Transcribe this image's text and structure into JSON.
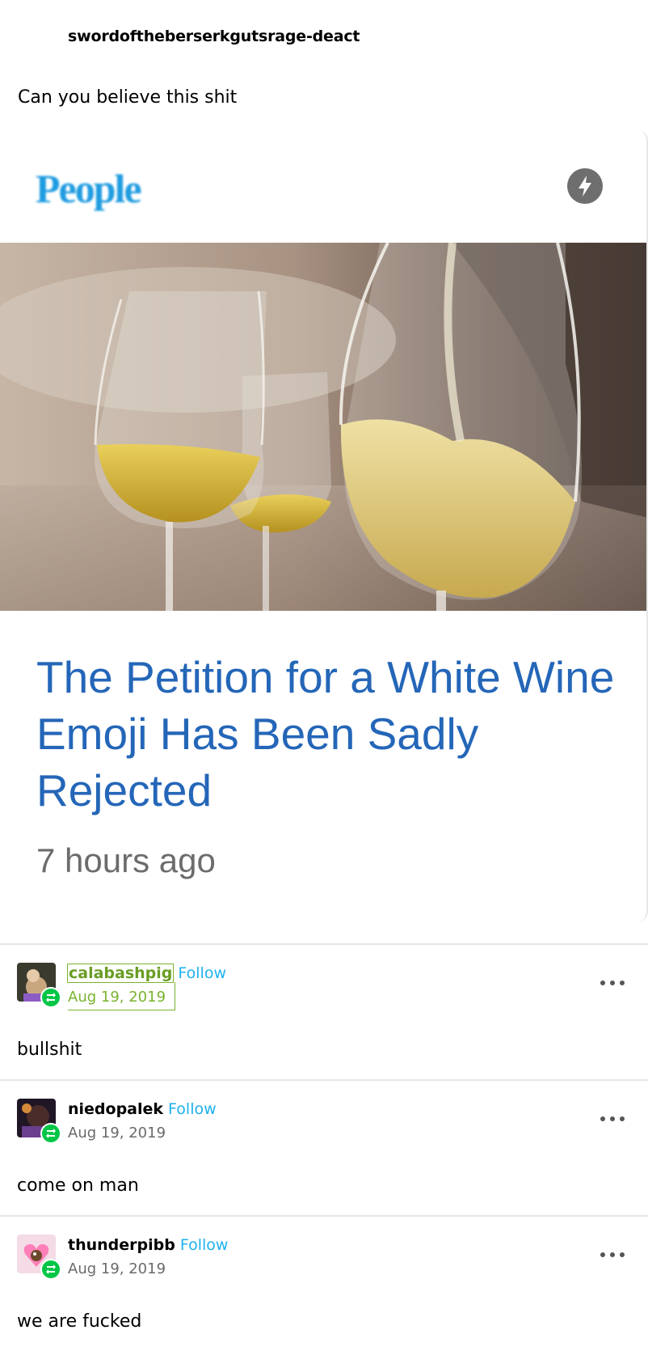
{
  "op": {
    "username": "swordoftheberserkgutsrage-deact",
    "text": "Can you believe this shit"
  },
  "card": {
    "source_logo": "People",
    "amp_icon": "lightning-bolt-icon",
    "title": "The Petition for a White Wine Emoji Has Been Sadly Rejected",
    "time": "7 hours ago"
  },
  "reblogs": [
    {
      "username": "calabashpig",
      "follow": "Follow",
      "date": "Aug 19, 2019",
      "text": "bullshit"
    },
    {
      "username": "niedopalek",
      "follow": "Follow",
      "date": "Aug 19, 2019",
      "text": "come on man"
    },
    {
      "username": "thunderpibb",
      "follow": "Follow",
      "date": "Aug 19, 2019",
      "text": "we are fucked"
    }
  ],
  "colors": {
    "follow": "#1eb1ee",
    "title_link": "#2466b8",
    "reblog_badge": "#00c646"
  }
}
